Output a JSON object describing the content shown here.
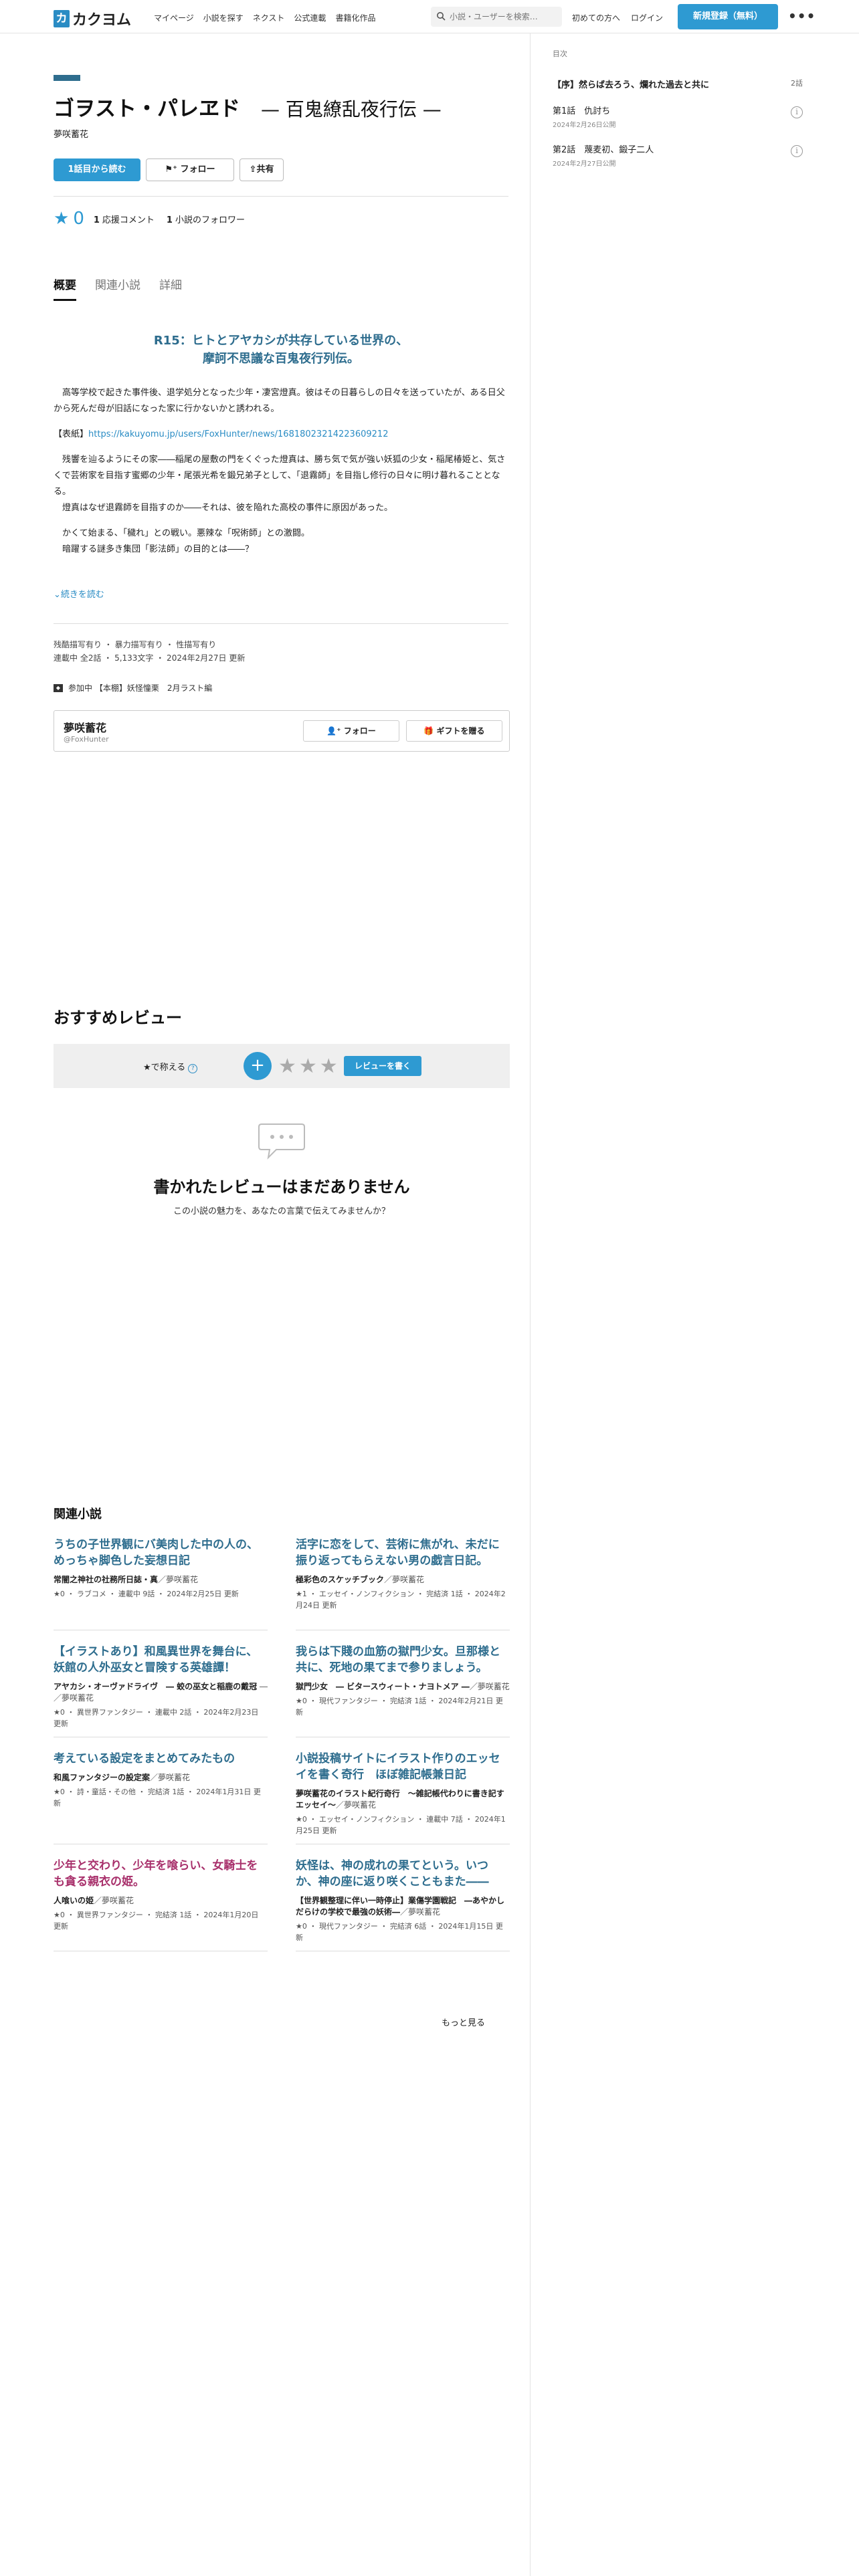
{
  "header": {
    "logo_mark": "カ",
    "logo_text": "カクヨム",
    "nav": [
      "マイページ",
      "小説を探す",
      "ネクスト",
      "公式連載",
      "書籍化作品"
    ],
    "search_placeholder": "小説・ユーザーを検索…",
    "first_visit": "初めての方へ",
    "login": "ログイン",
    "signup": "新規登録（無料）",
    "more": "•••"
  },
  "toc": {
    "label": "目次",
    "prologue_title": "【序】然らば去ろう、爛れた過去と共に",
    "prologue_count": "2話",
    "episodes": [
      {
        "title": "第1話　仇討ち",
        "date": "2024年2月26日公開"
      },
      {
        "title": "第2話　蔑麦初、鍛子二人",
        "date": "2024年2月27日公開"
      }
    ]
  },
  "work": {
    "title": "ゴヲスト・パレヱド",
    "subtitle": "— 百鬼繚乱夜行伝 —",
    "author": "夢咲蓄花",
    "read_button": "1話目から読む",
    "follow_button": "フォロー",
    "share_button": "共有",
    "star_count": "0",
    "stats": [
      {
        "num": "1",
        "label": "応援コメント"
      },
      {
        "num": "1",
        "label": "小説のフォロワー"
      }
    ]
  },
  "tabs": [
    "概要",
    "関連小説",
    "詳細"
  ],
  "summary": {
    "catchphrase_1": "R15：ヒトとアヤカシが共存している世界の、",
    "catchphrase_2": "摩訶不思議な百鬼夜行列伝。",
    "para1": "　高等学校で起きた事件後、退学処分となった少年・凄宮燈真。彼はその日暮らしの日々を送っていたが、ある日父から死んだ母が旧話になった家に行かないかと誘われる。",
    "para2_label": "【表紙】",
    "para2_link": "https://kakuyomu.jp/users/FoxHunter/news/16818023214223609212",
    "para3": "　残響を辿るようにその家――稲尾の屋敷の門をくぐった燈真は、勝ち気で気が強い妖狐の少女・稲尾椿姫と、気さくで芸術家を目指す蜜郷の少年・尾張光希を鍛兄弟子として、「退霧師」を目指し修行の日々に明け暮れることとなる。",
    "para4": "　燈真はなぜ退霧師を目指すのか――それは、彼を陥れた高校の事件に原因があった。",
    "para5": "　かくて始まる、「穢れ」との戦い。悪辣な「呪術師」との激闘。",
    "para6": "　暗躍する謎多き集団「影法師」の目的とは――？",
    "read_more": "続きを読む"
  },
  "meta": {
    "tags": "残酷描写有り ・ 暴力描写有り ・ 性描写有り",
    "status": "連載中 全2話 ・ 5,133文字 ・ 2024年2月27日 更新",
    "contest": "参加中 【本棚】妖怪憧栗　2月ラスト編"
  },
  "author_box": {
    "name": "夢咲蓄花",
    "id": "@FoxHunter",
    "follow": "フォロー",
    "gift": "ギフトを贈る"
  },
  "reviews": {
    "heading": "おすすめレビュー",
    "praise_label": "★で称える",
    "help": "?",
    "plus": "+",
    "stars": "★★★",
    "write_button": "レビューを書く",
    "empty_title": "書かれたレビューはまだありません",
    "empty_sub": "この小説の魅力を、あなたの言葉で伝えてみませんか？"
  },
  "related": {
    "heading": "関連小説",
    "items": [
      {
        "title": "うちの子世界観にバ美肉した中の人の、めっちゃ脚色した妄想日記",
        "sub": "常闇之神社の社務所日誌・真",
        "author": "／夢咲蓄花",
        "meta": "★0 ・ ラブコメ ・ 連載中 9話 ・ 2024年2月25日 更新",
        "color": "blue"
      },
      {
        "title": "活字に恋をして、芸術に焦がれ、未だに振り返ってもらえない男の戯言日記。",
        "sub": "極彩色のスケッチブック",
        "author": "／夢咲蓄花",
        "meta": "★1 ・ エッセイ・ノンフィクション ・ 完結済 1話 ・ 2024年2月24日 更新",
        "color": "blue"
      },
      {
        "title": "【イラストあり】和風異世界を舞台に、妖館の人外巫女と冒険する英雄譚！",
        "sub": "アヤカシ・オーヴァドライヴ　― 蛟の巫女と稲鹿の戴冠",
        "author": " ―／夢咲蓄花",
        "meta": "★0 ・ 異世界ファンタジー ・ 連載中 2話 ・ 2024年2月23日 更新",
        "color": "blue"
      },
      {
        "title": "我らは下賤の血筋の獄門少女。旦那様と共に、死地の果てまで参りましょう。",
        "sub": "獄門少女　― ビタースウィート・ナヨトメア ―",
        "author": "／夢咲蓄花",
        "meta": "★0 ・ 現代ファンタジー ・ 完結済 1話 ・ 2024年2月21日 更新",
        "color": "blue"
      },
      {
        "title": "考えている設定をまとめてみたもの",
        "sub": "和風ファンタジーの設定案",
        "author": "／夢咲蓄花",
        "meta": "★0 ・ 詩・童話・その他 ・ 完結済 1話 ・ 2024年1月31日 更新",
        "color": "blue"
      },
      {
        "title": "小説投稿サイトにイラスト作りのエッセイを書く奇行　ほぼ雑記帳兼日記",
        "sub": "夢咲蓄花のイラスト紀行奇行　～雑記帳代わりに書き記すエッセイ～",
        "author": "／夢咲蓄花",
        "meta": "★0 ・ エッセイ・ノンフィクション ・ 連載中 7話 ・ 2024年1月25日 更新",
        "color": "blue"
      },
      {
        "title": "少年と交わり、少年を喰らい、女騎士をも貪る親衣の姫。",
        "sub": "人喰いの姫",
        "author": "／夢咲蓄花",
        "meta": "★0 ・ 異世界ファンタジー ・ 完結済 1話 ・ 2024年1月20日 更新",
        "color": "pink"
      },
      {
        "title": "妖怪は、神の成れの果てという。いつか、神の座に返り咲くこともまた――",
        "sub": "【世界観整理に伴い一時停止】業傷学園戦記　―あやかしだらけの学校で最強の妖術―",
        "author": "／夢咲蓄花",
        "meta": "★0 ・ 現代ファンタジー ・ 完結済 6話 ・ 2024年1月15日 更新",
        "color": "blue"
      }
    ],
    "more": "もっと見る"
  }
}
